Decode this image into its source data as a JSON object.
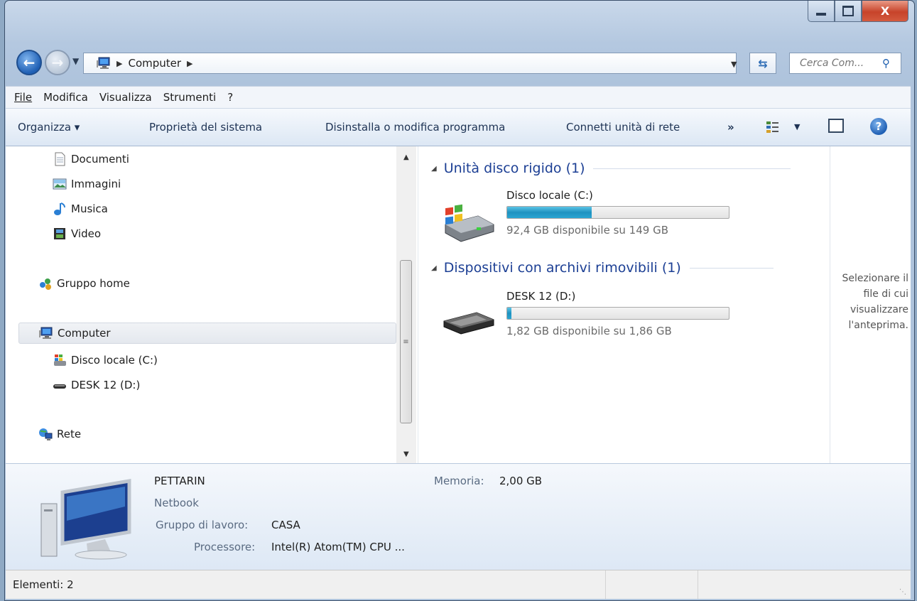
{
  "window": {
    "minimize_label": "—",
    "maximize_label": "☐",
    "close_label": "X"
  },
  "address": {
    "path_segment": "Computer",
    "search_placeholder": "Cerca Com..."
  },
  "menu": [
    "File",
    "Modifica",
    "Visualizza",
    "Strumenti",
    "?"
  ],
  "toolbar": {
    "organize": "Organizza ▾",
    "system_properties": "Proprietà del sistema",
    "uninstall": "Disinstalla o modifica programma",
    "map_drive": "Connetti unità di rete",
    "more": "»"
  },
  "nav": {
    "documents": "Documenti",
    "pictures": "Immagini",
    "music": "Musica",
    "video": "Video",
    "homegroup": "Gruppo home",
    "computer": "Computer",
    "drive_c": "Disco locale (C:)",
    "drive_d": "DESK 12 (D:)",
    "network": "Rete"
  },
  "groups": {
    "hdd_header": "Unità disco rigido (1)",
    "removable_header": "Dispositivi con archivi rimovibili (1)"
  },
  "drives": [
    {
      "name": "Disco locale (C:)",
      "info": "92,4 GB disponibile su 149 GB",
      "used_fraction": 0.38
    },
    {
      "name": "DESK 12 (D:)",
      "info": "1,82 GB disponibile su 1,86 GB",
      "used_fraction": 0.02
    }
  ],
  "preview": {
    "text": "Selezionare il file di cui visualizzare l'anteprima."
  },
  "details": {
    "computer_name": "PETTARIN",
    "description": "Netbook",
    "workgroup_label": "Gruppo di lavoro:",
    "workgroup_value": "CASA",
    "processor_label": "Processore:",
    "processor_value": "Intel(R) Atom(TM) CPU ...",
    "memory_label": "Memoria:",
    "memory_value": "2,00 GB"
  },
  "status": {
    "items": "Elementi: 2"
  }
}
